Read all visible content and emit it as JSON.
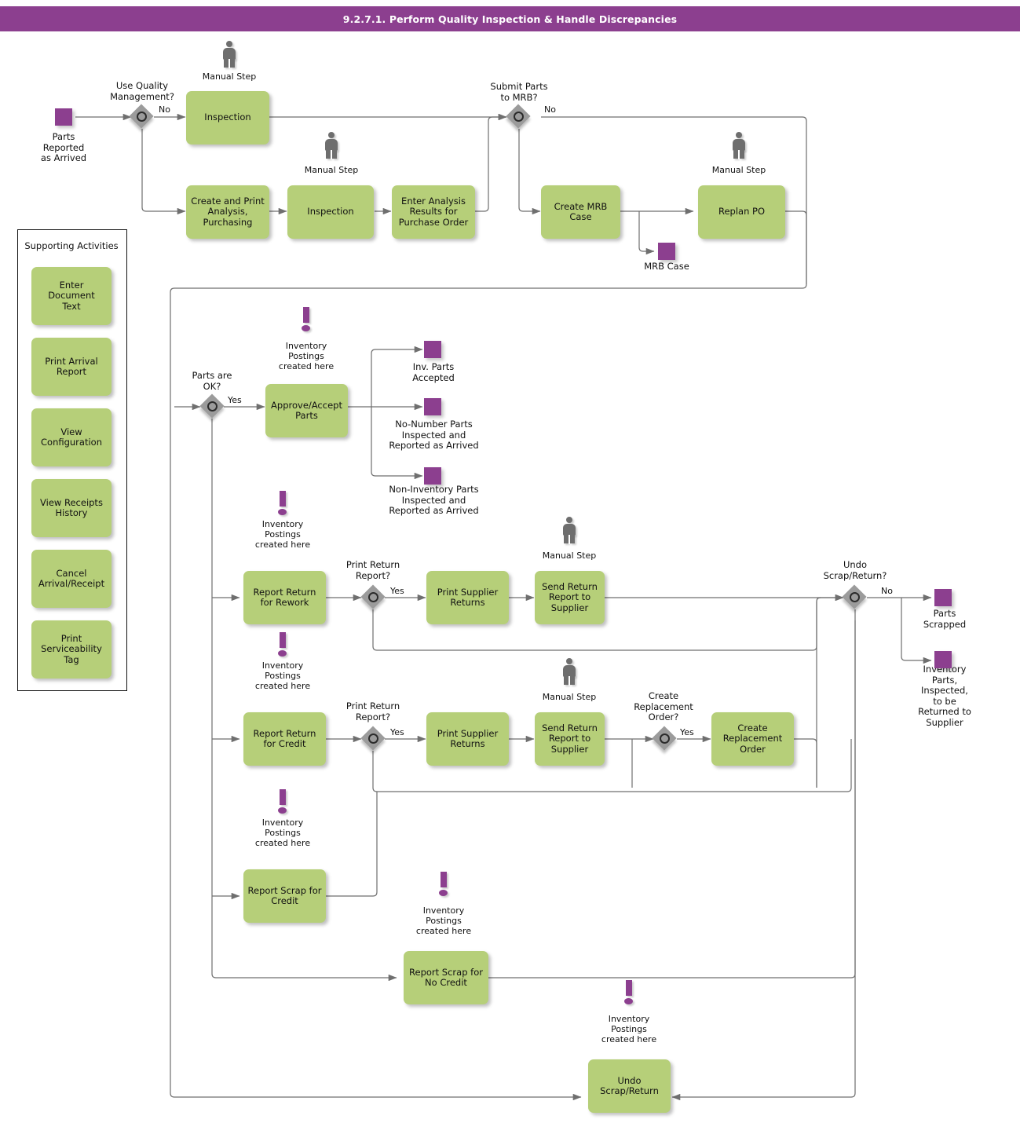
{
  "header": {
    "title": "9.2.7.1. Perform Quality Inspection & Handle Discrepancies",
    "bar_color": "#8c3f8f"
  },
  "colors": {
    "task_green": "#b6cf79",
    "event_purple": "#8c3f8f",
    "gateway_grey": "#9b9b9b",
    "connector_grey": "#6f6f6f",
    "person_grey": "#6e6e6e"
  },
  "icon_labels": {
    "manual_step": "Manual Step",
    "inventory_postings": "Inventory\nPostings\ncreated here"
  },
  "events": {
    "start_parts_arrived": "Parts\nReported\nas Arrived",
    "mrb_case": "MRB Case",
    "inv_parts_accepted": "Inv. Parts\nAccepted",
    "no_number_parts": "No-Number Parts\nInspected and\nReported as Arrived",
    "non_inventory_parts": "Non-Inventory Parts\nInspected and\nReported as Arrived",
    "parts_scrapped": "Parts\nScrapped",
    "inventory_parts_returned": "Inventory\nParts,\nInspected,\nto be\nReturned to\nSupplier"
  },
  "gateways": {
    "use_quality_management": "Use Quality\nManagement?",
    "submit_parts_to_mrb": "Submit Parts\nto MRB?",
    "parts_are_ok": "Parts are\nOK?",
    "print_return_report_rework": "Print Return\nReport?",
    "print_return_report_credit": "Print Return\nReport?",
    "create_replacement_order": "Create\nReplacement\nOrder?",
    "undo_scrap_return": "Undo\nScrap/Return?"
  },
  "flow_labels": {
    "no_1": "No",
    "no_2": "No",
    "yes_parts_ok": "Yes",
    "yes_rework_print": "Yes",
    "yes_credit_print": "Yes",
    "yes_replacement": "Yes",
    "no_undo": "No"
  },
  "tasks": {
    "inspection_top": "Inspection",
    "create_print_analysis": "Create and Print\nAnalysis,\nPurchasing",
    "inspection_mid": "Inspection",
    "enter_analysis_results": "Enter Analysis\nResults for\nPurchase Order",
    "create_mrb_case": "Create MRB\nCase",
    "replan_po": "Replan PO",
    "approve_accept_parts": "Approve/Accept\nParts",
    "report_return_rework": "Report Return\nfor Rework",
    "print_supplier_returns_1": "Print Supplier\nReturns",
    "send_return_report_1": "Send Return\nReport to\nSupplier",
    "report_return_credit": "Report Return\nfor Credit",
    "print_supplier_returns_2": "Print Supplier\nReturns",
    "send_return_report_2": "Send Return\nReport to\nSupplier",
    "create_replacement_order": "Create\nReplacement\nOrder",
    "report_scrap_credit": "Report Scrap for\nCredit",
    "report_scrap_no_credit": "Report Scrap for\nNo Credit",
    "undo_scrap_return": "Undo\nScrap/Return"
  },
  "supporting_activities": {
    "title": "Supporting Activities",
    "items": [
      "Enter Document\nText",
      "Print Arrival\nReport",
      "View\nConfiguration",
      "View Receipts\nHistory",
      "Cancel\nArrival/Receipt",
      "Print\nServiceability\nTag"
    ]
  }
}
